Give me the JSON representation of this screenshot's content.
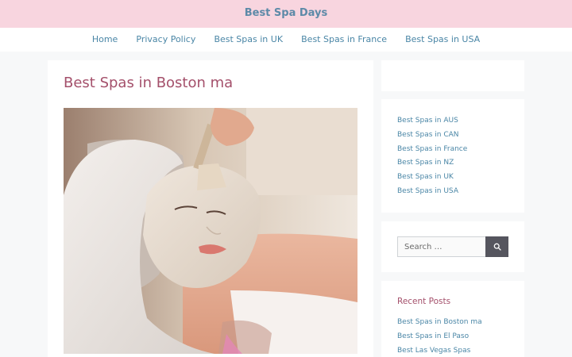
{
  "header": {
    "site_title": "Best Spa Days"
  },
  "nav": {
    "items": [
      {
        "label": "Home"
      },
      {
        "label": "Privacy Policy"
      },
      {
        "label": "Best Spas in UK"
      },
      {
        "label": "Best Spas in France"
      },
      {
        "label": "Best Spas in USA"
      }
    ]
  },
  "post": {
    "title": "Best Spas in Boston ma"
  },
  "sidebar": {
    "categories": [
      {
        "label": "Best Spas in AUS"
      },
      {
        "label": "Best Spas in CAN"
      },
      {
        "label": "Best Spas in France"
      },
      {
        "label": "Best Spas in NZ"
      },
      {
        "label": "Best Spas in UK"
      },
      {
        "label": "Best Spas in USA"
      }
    ],
    "search": {
      "placeholder": "Search …"
    },
    "recent_posts": {
      "title": "Recent Posts",
      "items": [
        {
          "label": "Best Spas in Boston ma"
        },
        {
          "label": "Best Spas in El Paso"
        },
        {
          "label": "Best Las Vegas Spas"
        }
      ]
    }
  }
}
